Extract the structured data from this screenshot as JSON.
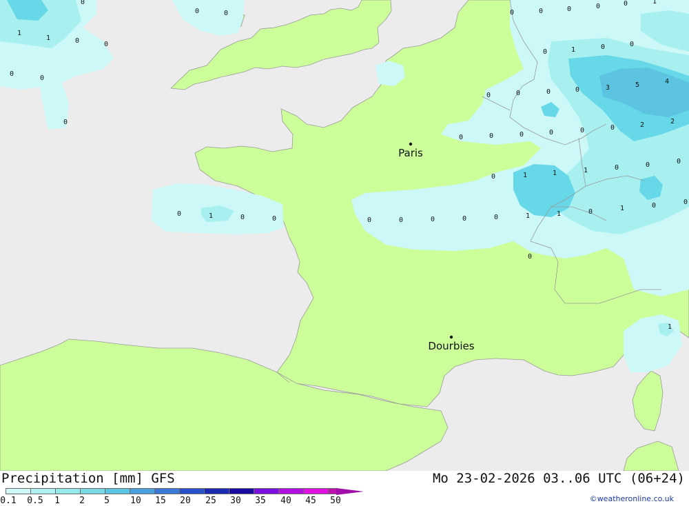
{
  "map": {
    "title_left": "Precipitation [mm] GFS",
    "title_right": "Mo 23-02-2026 03..06 UTC (06+24)",
    "credit": "©weatheronline.co.uk",
    "cities": [
      {
        "name": "Paris"
      },
      {
        "name": "Dourbies"
      }
    ],
    "precip_values": [
      "0",
      "1",
      "1",
      "0",
      "0",
      "0",
      "0",
      "0",
      "0",
      "0",
      "0",
      "0",
      "0",
      "0",
      "1",
      "0",
      "0",
      "0",
      "0",
      "1",
      "0",
      "0",
      "0",
      "0",
      "0",
      "0",
      "0",
      "0",
      "3",
      "5",
      "4",
      "0",
      "0",
      "0",
      "0",
      "2",
      "2",
      "0",
      "1",
      "1",
      "1",
      "0",
      "0",
      "0",
      "1",
      "0",
      "1",
      "1",
      "0",
      "1",
      "0",
      "0",
      "0",
      "1"
    ],
    "legend": {
      "labels": [
        "0.1",
        "0.5",
        "1",
        "2",
        "5",
        "10",
        "15",
        "20",
        "25",
        "30",
        "35",
        "40",
        "45",
        "50"
      ],
      "colors": [
        "#d0f8f8",
        "#b0f0f0",
        "#98eaea",
        "#7ad8e4",
        "#5cc4e0",
        "#4aa0dc",
        "#3a7ad6",
        "#2850c8",
        "#1a2ab0",
        "#1a0aa0",
        "#7a10e0",
        "#b010e0",
        "#e010e0",
        "#c010b0"
      ],
      "arrow_color": "#a010a8"
    },
    "colors": {
      "sea": "#ececec",
      "land": "#ccff99",
      "precip_light": "#ccf8f8",
      "precip_mid": "#a8f0f0",
      "precip_heavy": "#66d8e8"
    }
  }
}
